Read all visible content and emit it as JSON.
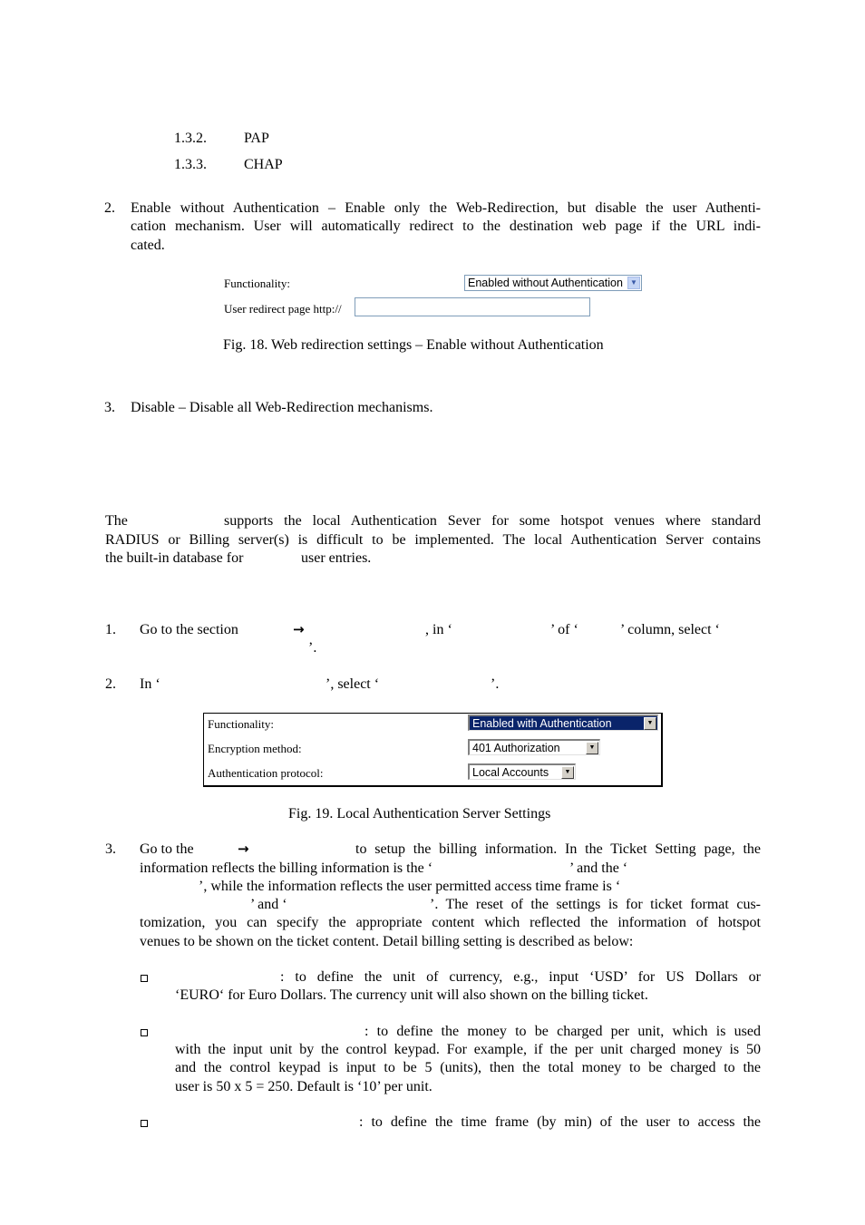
{
  "sublist": [
    {
      "num": "1.3.2.",
      "label": "PAP"
    },
    {
      "num": "1.3.3.",
      "label": "CHAP"
    }
  ],
  "item2": {
    "num": "2.",
    "lines": [
      "Enable without Authentication – Enable only the Web-Redirection, but disable the user Authenti-",
      "cation mechanism. User will automatically redirect to the destination web page if the URL indi-",
      "cated."
    ]
  },
  "fig18": {
    "functionality_label": "Functionality:",
    "functionality_value": "Enabled without Authentication",
    "redirect_label": "User redirect page http://",
    "redirect_value": "",
    "caption": "Fig. 18. Web redirection settings – Enable without Authentication"
  },
  "item3": {
    "num": "3.",
    "text": "Disable – Disable all Web-Redirection mechanisms."
  },
  "intro": {
    "line1_a": "The",
    "line1_b": "supports the local Authentication Sever for some hotspot venues where standard",
    "line2": "RADIUS or Billing server(s) is difficult to be implemented. The local Authentication Server contains",
    "line3_a": "the built-in database for",
    "line3_b": "user entries."
  },
  "steps": {
    "s1": {
      "num": "1.",
      "a": "Go to the section",
      "arrow": "→",
      "b": ", in ‘",
      "c": "’ of ‘",
      "d": "’ column, select ‘",
      "e": "’."
    },
    "s2": {
      "num": "2.",
      "a": "In ‘",
      "b": "’, select ‘",
      "c": "’."
    },
    "s3": {
      "num": "3.",
      "l1_a": "Go to the",
      "arrow": "→",
      "l1_b": "to setup the billing information. In the Ticket Setting page, the",
      "l2_a": "information reflects the billing information is the ‘",
      "l2_b": "’ and the ‘",
      "l3": "’, while the information reflects the user permitted access time frame is ‘",
      "l4_a": "’ and ‘",
      "l4_b": "’. The reset of the settings is for ticket format cus-",
      "l5": "tomization, you can specify the appropriate content which reflected the information of hotspot",
      "l6": "venues to be shown on the ticket content. Detail billing setting is described as below:"
    }
  },
  "fig19": {
    "rows": [
      {
        "label": "Functionality:",
        "value": "Enabled with Authentication"
      },
      {
        "label": "Encryption method:",
        "value": "401 Authorization"
      },
      {
        "label": "Authentication protocol:",
        "value": "Local Accounts"
      }
    ],
    "caption": "Fig. 19. Local Authentication Server Settings"
  },
  "bullets": [
    {
      "l1": ": to define the unit of currency, e.g., input ‘USD’ for US Dollars or",
      "rest": [
        "‘EURO‘ for Euro Dollars. The currency unit will also shown on the billing ticket."
      ]
    },
    {
      "l1": ": to define the money to be charged per unit, which is used",
      "rest": [
        "with the input unit by the control keypad. For example, if the per unit charged money is 50",
        "and the control keypad is input to be 5 (units), then the total money to be charged to the",
        "user is 50 x 5 = 250. Default is ‘10’ per unit."
      ]
    },
    {
      "l1": ": to define the time frame (by min) of the user to access the",
      "rest": []
    }
  ]
}
